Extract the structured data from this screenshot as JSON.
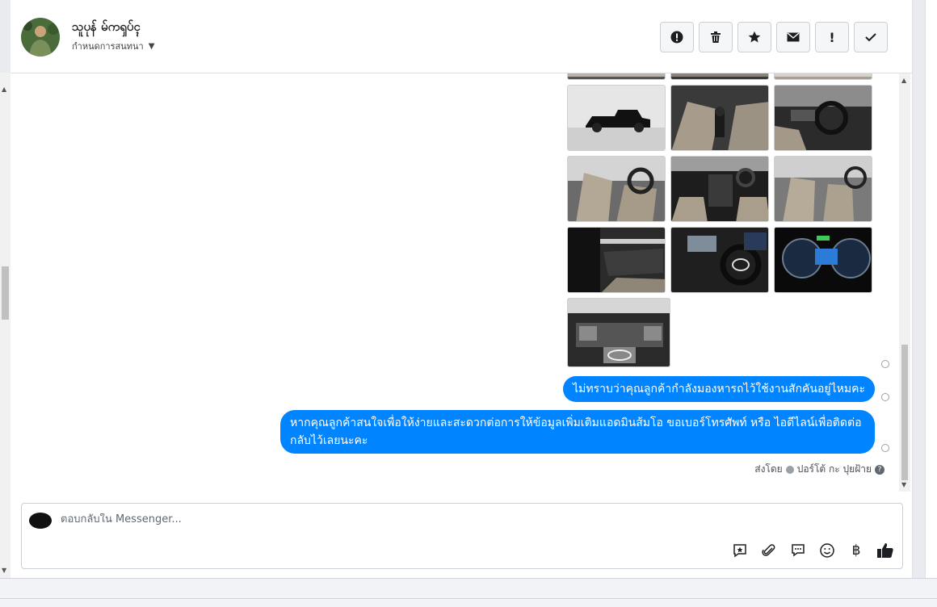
{
  "header": {
    "name": "သူပုန် မ်ကၡပ်ၚ",
    "assign_label": "กำหนดการสนทนา"
  },
  "actions": [
    {
      "name": "spam-button",
      "icon": "alert-circle-icon"
    },
    {
      "name": "delete-button",
      "icon": "trash-icon"
    },
    {
      "name": "star-button",
      "icon": "star-icon"
    },
    {
      "name": "mark-unread-button",
      "icon": "envelope-icon"
    },
    {
      "name": "follow-up-button",
      "icon": "exclamation-icon"
    },
    {
      "name": "done-button",
      "icon": "check-icon"
    }
  ],
  "messages": [
    {
      "text": "ไม่ทราบว่าคุณลูกค้ากำลังมองหารถไว้ใช้งานสักคันอยู่ไหมคะ"
    },
    {
      "text": "หากคุณลูกค้าสนใจเพื่อให้ง่ายและสะดวกต่อการให้ข้อมูลเพิ่มเติมแอดมินส้มโอ ขอเบอร์โทรศัพท์ หรือ ไอดีไลน์เพื่อติดต่อกลับไว้เลยนะคะ"
    }
  ],
  "sent_by": {
    "prefix": "ส่งโดย",
    "agent": "ปอร์โต้ กะ ปุยฝ้าย"
  },
  "composer": {
    "placeholder": "ตอบกลับใน Messenger..."
  },
  "colors": {
    "bubble": "#0084ff"
  }
}
